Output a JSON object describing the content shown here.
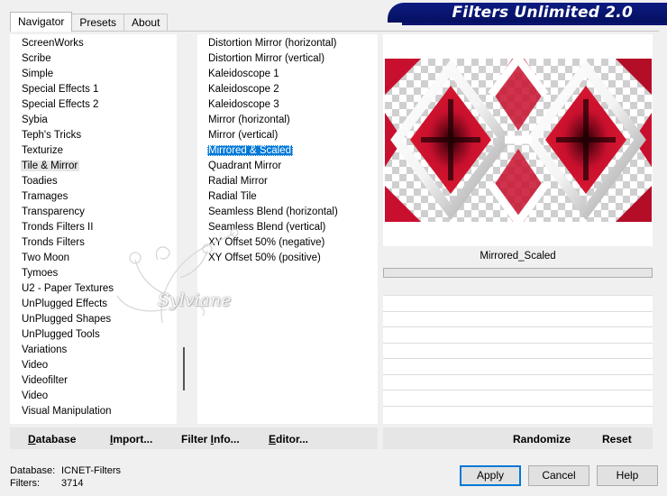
{
  "tabs": [
    {
      "label": "Navigator",
      "active": true
    },
    {
      "label": "Presets",
      "active": false
    },
    {
      "label": "About",
      "active": false
    }
  ],
  "banner": {
    "title": "Filters Unlimited 2.0"
  },
  "categories": {
    "items": [
      "ScreenWorks",
      "Scribe",
      "Simple",
      "Special Effects 1",
      "Special Effects 2",
      "Sybia",
      "Teph's Tricks",
      "Texturize",
      "Tile & Mirror",
      "Toadies",
      "Tramages",
      "Transparency",
      "Tronds Filters II",
      "Tronds Filters",
      "Two Moon",
      "Tymoes",
      "U2 - Paper Textures",
      "UnPlugged Effects",
      "UnPlugged Shapes",
      "UnPlugged Tools",
      "Variations",
      "Video",
      "Videofilter",
      "Video",
      "Visual Manipulation"
    ],
    "selected_index": 8
  },
  "filters": {
    "items": [
      "Distortion Mirror (horizontal)",
      "Distortion Mirror (vertical)",
      "Kaleidoscope 1",
      "Kaleidoscope 2",
      "Kaleidoscope 3",
      "Mirror (horizontal)",
      "Mirror (vertical)",
      "Mirrored & Scaled",
      "Quadrant Mirror",
      "Radial Mirror",
      "Radial Tile",
      "Seamless Blend (horizontal)",
      "Seamless Blend (vertical)",
      "XY Offset 50% (negative)",
      "XY Offset 50% (positive)"
    ],
    "selected_index": 7
  },
  "watermark": {
    "text": "Sylviane"
  },
  "preview": {
    "filter_name": "Mirrored_Scaled"
  },
  "commands_left": [
    {
      "label": "Database",
      "underline": "D",
      "rest": "atabase"
    },
    {
      "label": "Import...",
      "underline": "I",
      "rest": "mport..."
    },
    {
      "label": "Filter Info...",
      "pre": "Filter ",
      "underline": "I",
      "rest": "nfo..."
    },
    {
      "label": "Editor...",
      "underline": "E",
      "rest": "ditor..."
    }
  ],
  "commands_right": {
    "randomize": "Randomize",
    "reset": "Reset"
  },
  "info": {
    "database_label": "Database:",
    "database_value": "ICNET-Filters",
    "filters_label": "Filters:",
    "filters_value": "3714"
  },
  "buttons": {
    "apply": "Apply",
    "cancel": "Cancel",
    "help": "Help"
  },
  "colors": {
    "banner": "#0d1c82",
    "selection": "#0078d7",
    "preview_red": "#c8102e"
  }
}
